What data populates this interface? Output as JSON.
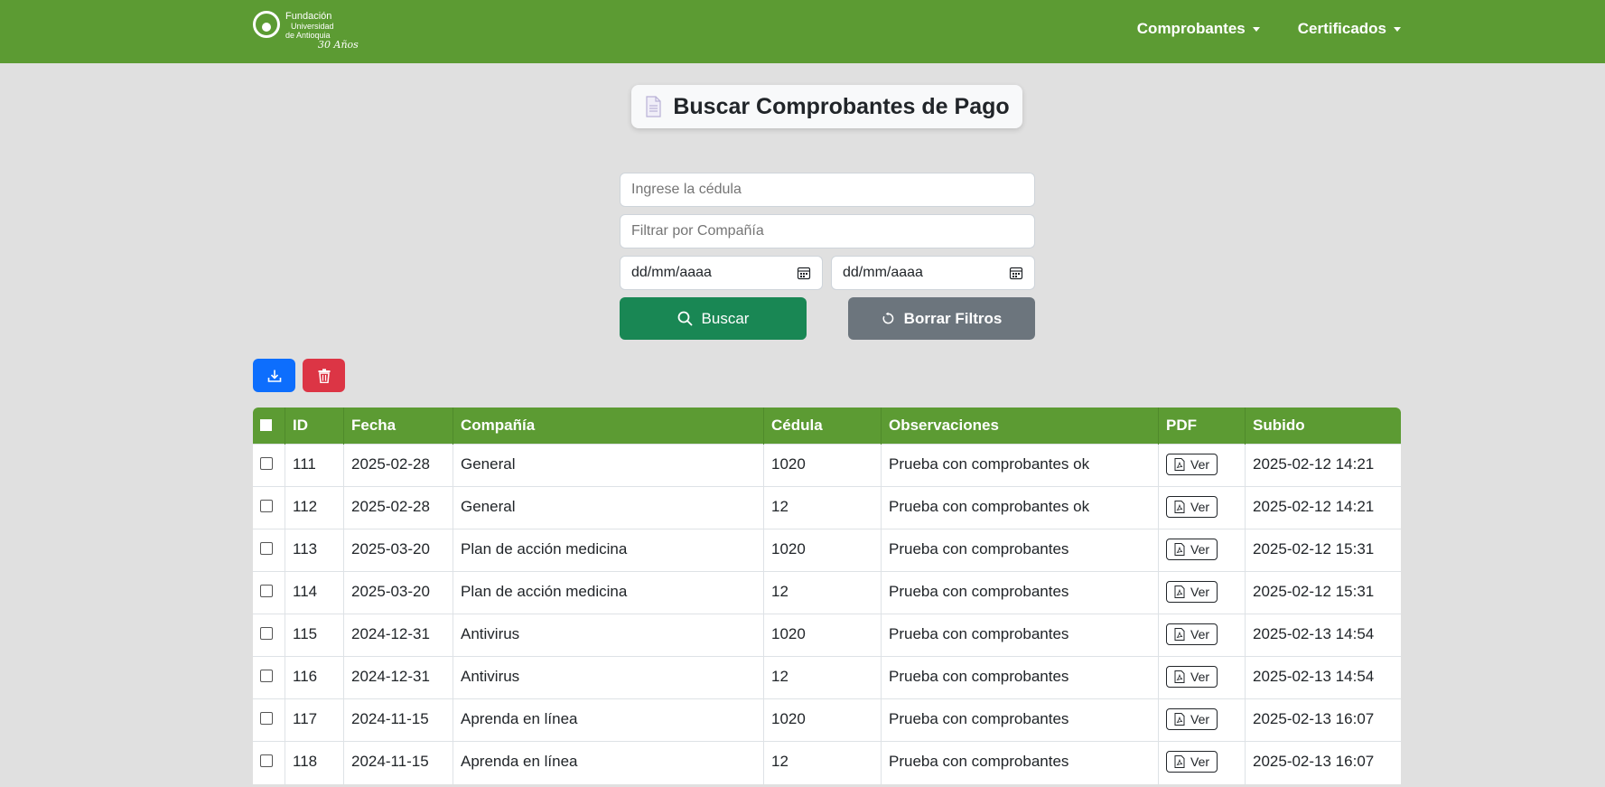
{
  "navbar": {
    "logo": {
      "line1": "Fundación",
      "line2": "Universidad",
      "line3": "de Antioquia",
      "line4": "30 Años"
    },
    "menu": [
      {
        "label": "Comprobantes"
      },
      {
        "label": "Certificados"
      }
    ]
  },
  "page": {
    "title": "Buscar Comprobantes de Pago",
    "title_icon": "document-icon"
  },
  "filters": {
    "cedula_placeholder": "Ingrese la cédula",
    "compania_placeholder": "Filtrar por Compañía",
    "date_from": "dd/mm/aaaa",
    "date_to": "dd/mm/aaaa",
    "buscar_label": "Buscar",
    "borrar_label": "Borrar Filtros"
  },
  "actions": {
    "download_icon": "download-icon",
    "delete_icon": "trash-icon"
  },
  "table": {
    "headers": [
      "ID",
      "Fecha",
      "Compañía",
      "Cédula",
      "Observaciones",
      "PDF",
      "Subido"
    ],
    "ver_label": "Ver",
    "rows": [
      {
        "id": "111",
        "fecha": "2025-02-28",
        "compania": "General",
        "cedula": "1020",
        "obs": "Prueba con comprobantes ok",
        "subido": "2025-02-12 14:21"
      },
      {
        "id": "112",
        "fecha": "2025-02-28",
        "compania": "General",
        "cedula": "12",
        "obs": "Prueba con comprobantes ok",
        "subido": "2025-02-12 14:21"
      },
      {
        "id": "113",
        "fecha": "2025-03-20",
        "compania": "Plan de acción medicina",
        "cedula": "1020",
        "obs": "Prueba con comprobantes",
        "subido": "2025-02-12 15:31"
      },
      {
        "id": "114",
        "fecha": "2025-03-20",
        "compania": "Plan de acción medicina",
        "cedula": "12",
        "obs": "Prueba con comprobantes",
        "subido": "2025-02-12 15:31"
      },
      {
        "id": "115",
        "fecha": "2024-12-31",
        "compania": "Antivirus",
        "cedula": "1020",
        "obs": "Prueba con comprobantes",
        "subido": "2025-02-13 14:54"
      },
      {
        "id": "116",
        "fecha": "2024-12-31",
        "compania": "Antivirus",
        "cedula": "12",
        "obs": "Prueba con comprobantes",
        "subido": "2025-02-13 14:54"
      },
      {
        "id": "117",
        "fecha": "2024-11-15",
        "compania": "Aprenda en línea",
        "cedula": "1020",
        "obs": "Prueba con comprobantes",
        "subido": "2025-02-13 16:07"
      },
      {
        "id": "118",
        "fecha": "2024-11-15",
        "compania": "Aprenda en línea",
        "cedula": "12",
        "obs": "Prueba con comprobantes",
        "subido": "2025-02-13 16:07"
      }
    ]
  },
  "colors": {
    "navbar": "#5c9b33",
    "background": "#e0e0e0",
    "buscar": "#198754",
    "borrar": "#6c757d",
    "download": "#0d6efd",
    "delete": "#dc3545"
  }
}
